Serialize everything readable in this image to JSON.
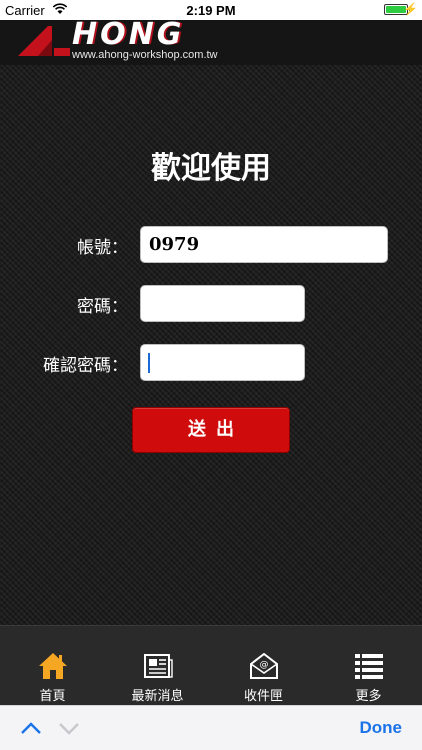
{
  "status_bar": {
    "carrier": "Carrier",
    "time": "2:19 PM",
    "battery_icon": "battery-charging-icon"
  },
  "header": {
    "logo_text": "HONG",
    "logo_url": "www.ahong-workshop.com.tw"
  },
  "form": {
    "title": "歡迎使用",
    "account_label": "帳號：",
    "account_value": "0979",
    "password_label": "密碼：",
    "password_value": "",
    "confirm_label": "確認密碼：",
    "confirm_value": "",
    "submit_label": "送出"
  },
  "tabbar": {
    "items": [
      {
        "label": "首頁",
        "icon": "home-icon"
      },
      {
        "label": "最新消息",
        "icon": "newspaper-icon"
      },
      {
        "label": "收件匣",
        "icon": "inbox-icon"
      },
      {
        "label": "更多",
        "icon": "more-list-icon"
      }
    ]
  },
  "accessory": {
    "done_label": "Done"
  },
  "colors": {
    "accent_red": "#d00b0b",
    "home_icon_orange": "#f5a623",
    "done_blue": "#1a73e8"
  }
}
